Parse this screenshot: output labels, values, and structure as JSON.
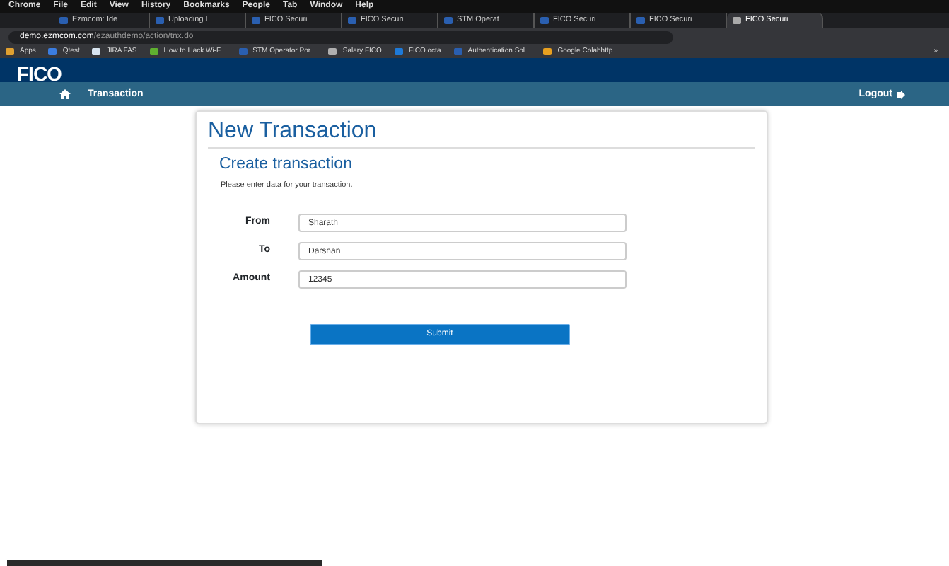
{
  "menu_bar": {
    "app": "Chrome",
    "items": [
      "File",
      "Edit",
      "View",
      "History",
      "Bookmarks",
      "People",
      "Tab",
      "Window",
      "Help"
    ]
  },
  "tabs": [
    {
      "label": "Ezmcom: Ide",
      "selected": false
    },
    {
      "label": "Uploading I",
      "selected": false
    },
    {
      "label": "FICO Securi",
      "selected": false
    },
    {
      "label": "FICO Securi",
      "selected": false
    },
    {
      "label": "STM Operat",
      "selected": false
    },
    {
      "label": "FICO Securi",
      "selected": false
    },
    {
      "label": "FICO Securi",
      "selected": false
    },
    {
      "label": "FICO Securi",
      "selected": true
    }
  ],
  "address_bar": {
    "host": "demo.ezmcom.com",
    "path": "/ezauthdemo/action/tnx.do"
  },
  "bookmarks": [
    {
      "label": "Apps",
      "color": "#e0a030"
    },
    {
      "label": "Qtest",
      "color": "#3b7de0"
    },
    {
      "label": "JIRA FAS",
      "color": "#d8e4f0"
    },
    {
      "label": "How to Hack Wi-F...",
      "color": "#5fb030"
    },
    {
      "label": "STM Operator Por...",
      "color": "#2a5fb0"
    },
    {
      "label": "Salary FICO",
      "color": "#b0b0b0"
    },
    {
      "label": "FICO octa",
      "color": "#1e7ad8"
    },
    {
      "label": "Authentication Sol...",
      "color": "#2a5fb0"
    },
    {
      "label": "Google Colabhttp...",
      "color": "#e8a020"
    }
  ],
  "bookmarks_more": "»",
  "header": {
    "logo": "FICO"
  },
  "nav": {
    "items": [
      "Transaction"
    ],
    "logout": "Logout"
  },
  "card": {
    "title": "New Transaction",
    "subtitle": "Create transaction",
    "intro": "Please enter data for your transaction.",
    "fields": [
      {
        "label": "From",
        "value": "Sharath"
      },
      {
        "label": "To",
        "value": "Darshan"
      },
      {
        "label": "Amount",
        "value": "12345"
      }
    ],
    "submit": "Submit"
  }
}
